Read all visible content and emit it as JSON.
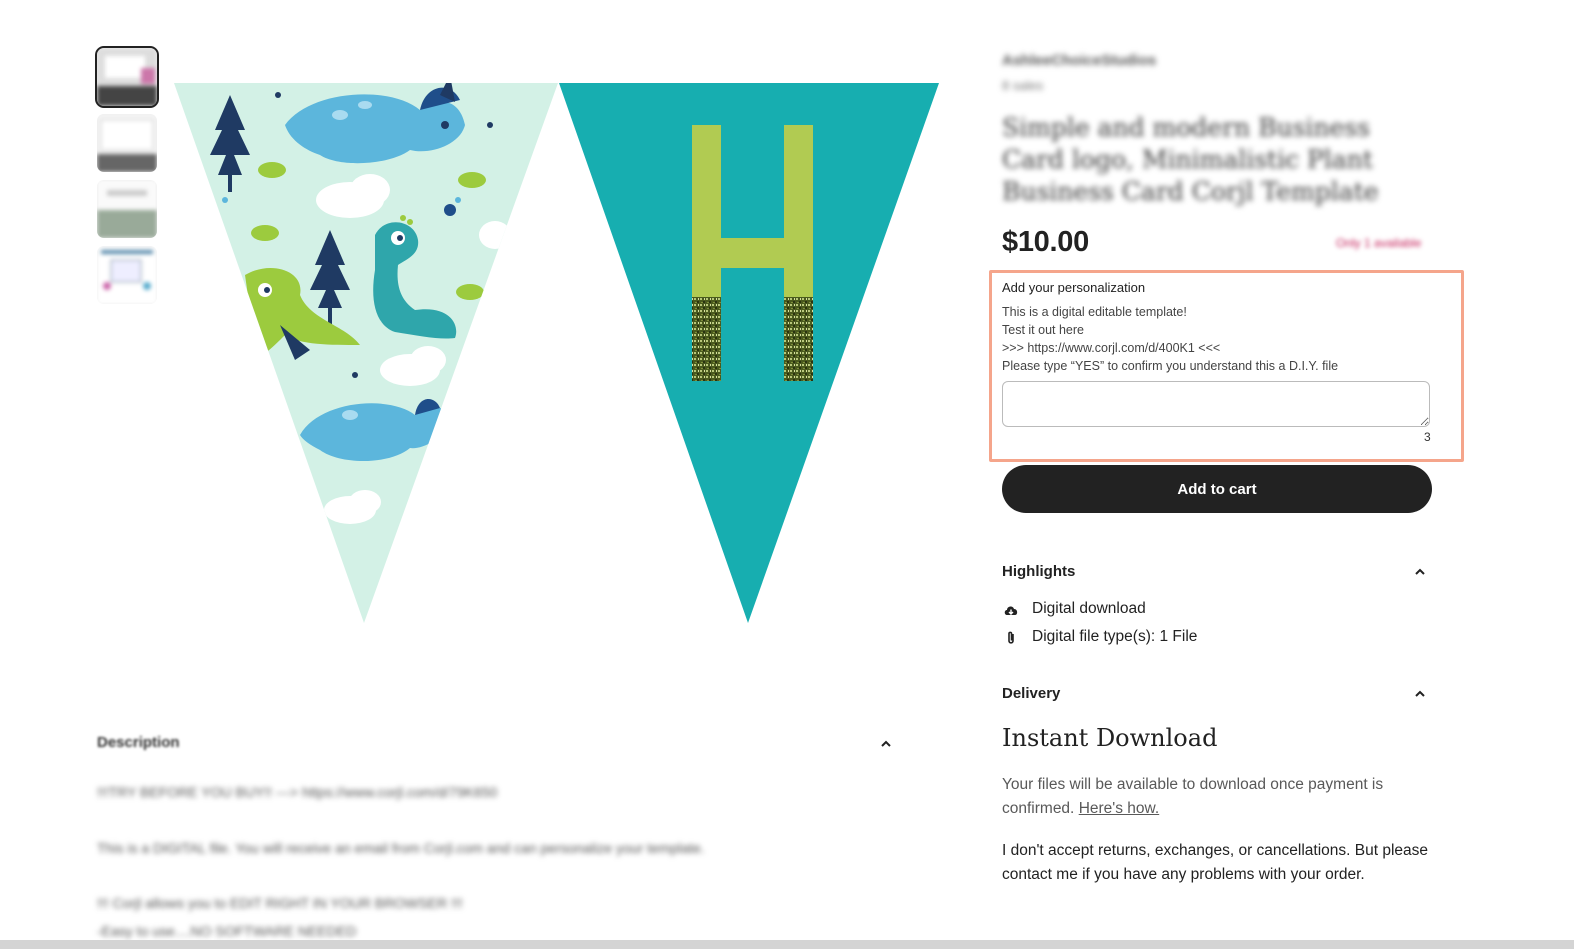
{
  "shop": {
    "name": "AshleeChoiceStudios",
    "sales": "8 sales"
  },
  "listing": {
    "title": "Simple and modern Business Card logo, Minimalistic Plant Business Card Corjl Template",
    "price": "$10.00",
    "stock": "Only 1 available"
  },
  "banner": {
    "letter": "H"
  },
  "personalization": {
    "title": "Add your personalization",
    "lines": [
      "This is a digital editable template!",
      "Test it out here",
      ">>> https://www.corjl.com/d/400K1 <<<",
      "Please type “YES” to confirm you understand this a D.I.Y. file"
    ],
    "input_value": "",
    "counter": "3"
  },
  "cart": {
    "label": "Add to cart"
  },
  "highlights": {
    "title": "Highlights",
    "items": [
      {
        "icon": "cloud-download-icon",
        "label": "Digital download"
      },
      {
        "icon": "paperclip-icon",
        "label": "Digital file type(s): 1 File"
      }
    ]
  },
  "delivery": {
    "title": "Delivery",
    "heading": "Instant Download",
    "text": "Your files will be available to download once payment is confirmed.",
    "link": "Here's how.",
    "policy": "I don't accept returns, exchanges, or cancellations. But please contact me if you have any problems with your order."
  },
  "description": {
    "title": "Description",
    "lines": [
      "!!!TRY BEFORE YOU BUY!! ---> https://www.corjl.com/d/79K650",
      "This is a DIGITAL file. You will receive an email from Corjl.com and can personalize your template.",
      "!!! Corjl allows you to EDIT RIGHT IN YOUR BROWSER !!!",
      "-Easy to use....NO SOFTWARE NEEDED"
    ]
  },
  "colors": {
    "accent_border": "#f5a58b",
    "button_bg": "#222222",
    "teal": "#17aeb0",
    "mint": "#d3f1e6",
    "lime": "#b1cb52",
    "stock_red": "#c4205a"
  }
}
